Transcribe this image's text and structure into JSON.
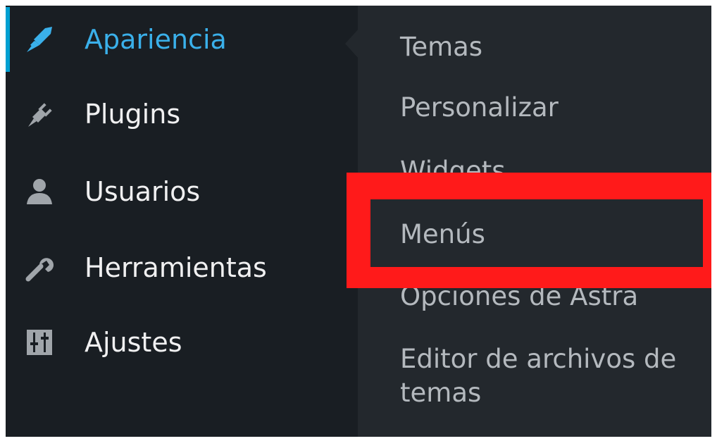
{
  "sidebar": {
    "items": [
      {
        "label": "Apariencia",
        "icon": "paintbrush-icon",
        "active": true
      },
      {
        "label": "Plugins",
        "icon": "plug-icon",
        "active": false
      },
      {
        "label": "Usuarios",
        "icon": "user-icon",
        "active": false
      },
      {
        "label": "Herramientas",
        "icon": "wrench-icon",
        "active": false
      },
      {
        "label": "Ajustes",
        "icon": "sliders-icon",
        "active": false
      }
    ]
  },
  "submenu": {
    "items": [
      {
        "label": "Temas"
      },
      {
        "label": "Personalizar"
      },
      {
        "label": "Widgets"
      },
      {
        "label": "Menús"
      },
      {
        "label": "Opciones de Astra"
      },
      {
        "label": "Editor de archivos de temas"
      }
    ]
  },
  "colors": {
    "sidebar_bg": "#191e23",
    "submenu_bg": "#23282d",
    "active_accent": "#00a0d2",
    "active_text": "#3ab0ea",
    "text": "#f0f0f1",
    "submenu_text": "#b4b9be",
    "highlight": "#ff1a1a"
  }
}
